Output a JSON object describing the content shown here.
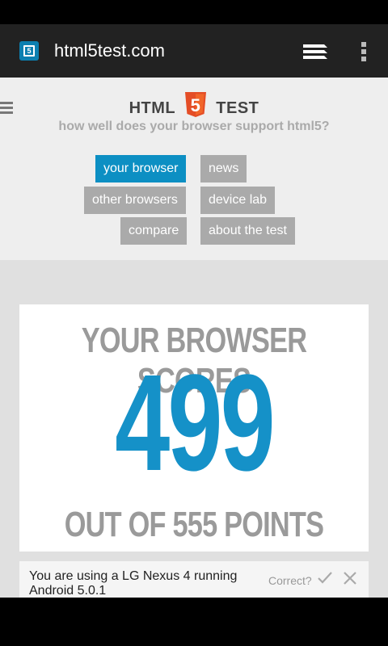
{
  "browser": {
    "url": "html5test.com"
  },
  "site": {
    "logo_left": "HTML",
    "logo_badge": "5",
    "logo_right": "TEST",
    "tagline": "how well does your browser support html5?",
    "nav": {
      "your_browser": "your browser",
      "news": "news",
      "other_browsers": "other browsers",
      "device_lab": "device lab",
      "compare": "compare",
      "about": "about the test"
    }
  },
  "score": {
    "title": "YOUR BROWSER SCORES",
    "value": "499",
    "total": "OUT OF 555 POINTS"
  },
  "device": {
    "message": "You are using a LG Nexus 4 running Android 5.0.1",
    "correct_label": "Correct?"
  },
  "colors": {
    "accent": "#0c8fc3",
    "score": "#1591c8",
    "html5_orange": "#e44d26"
  }
}
